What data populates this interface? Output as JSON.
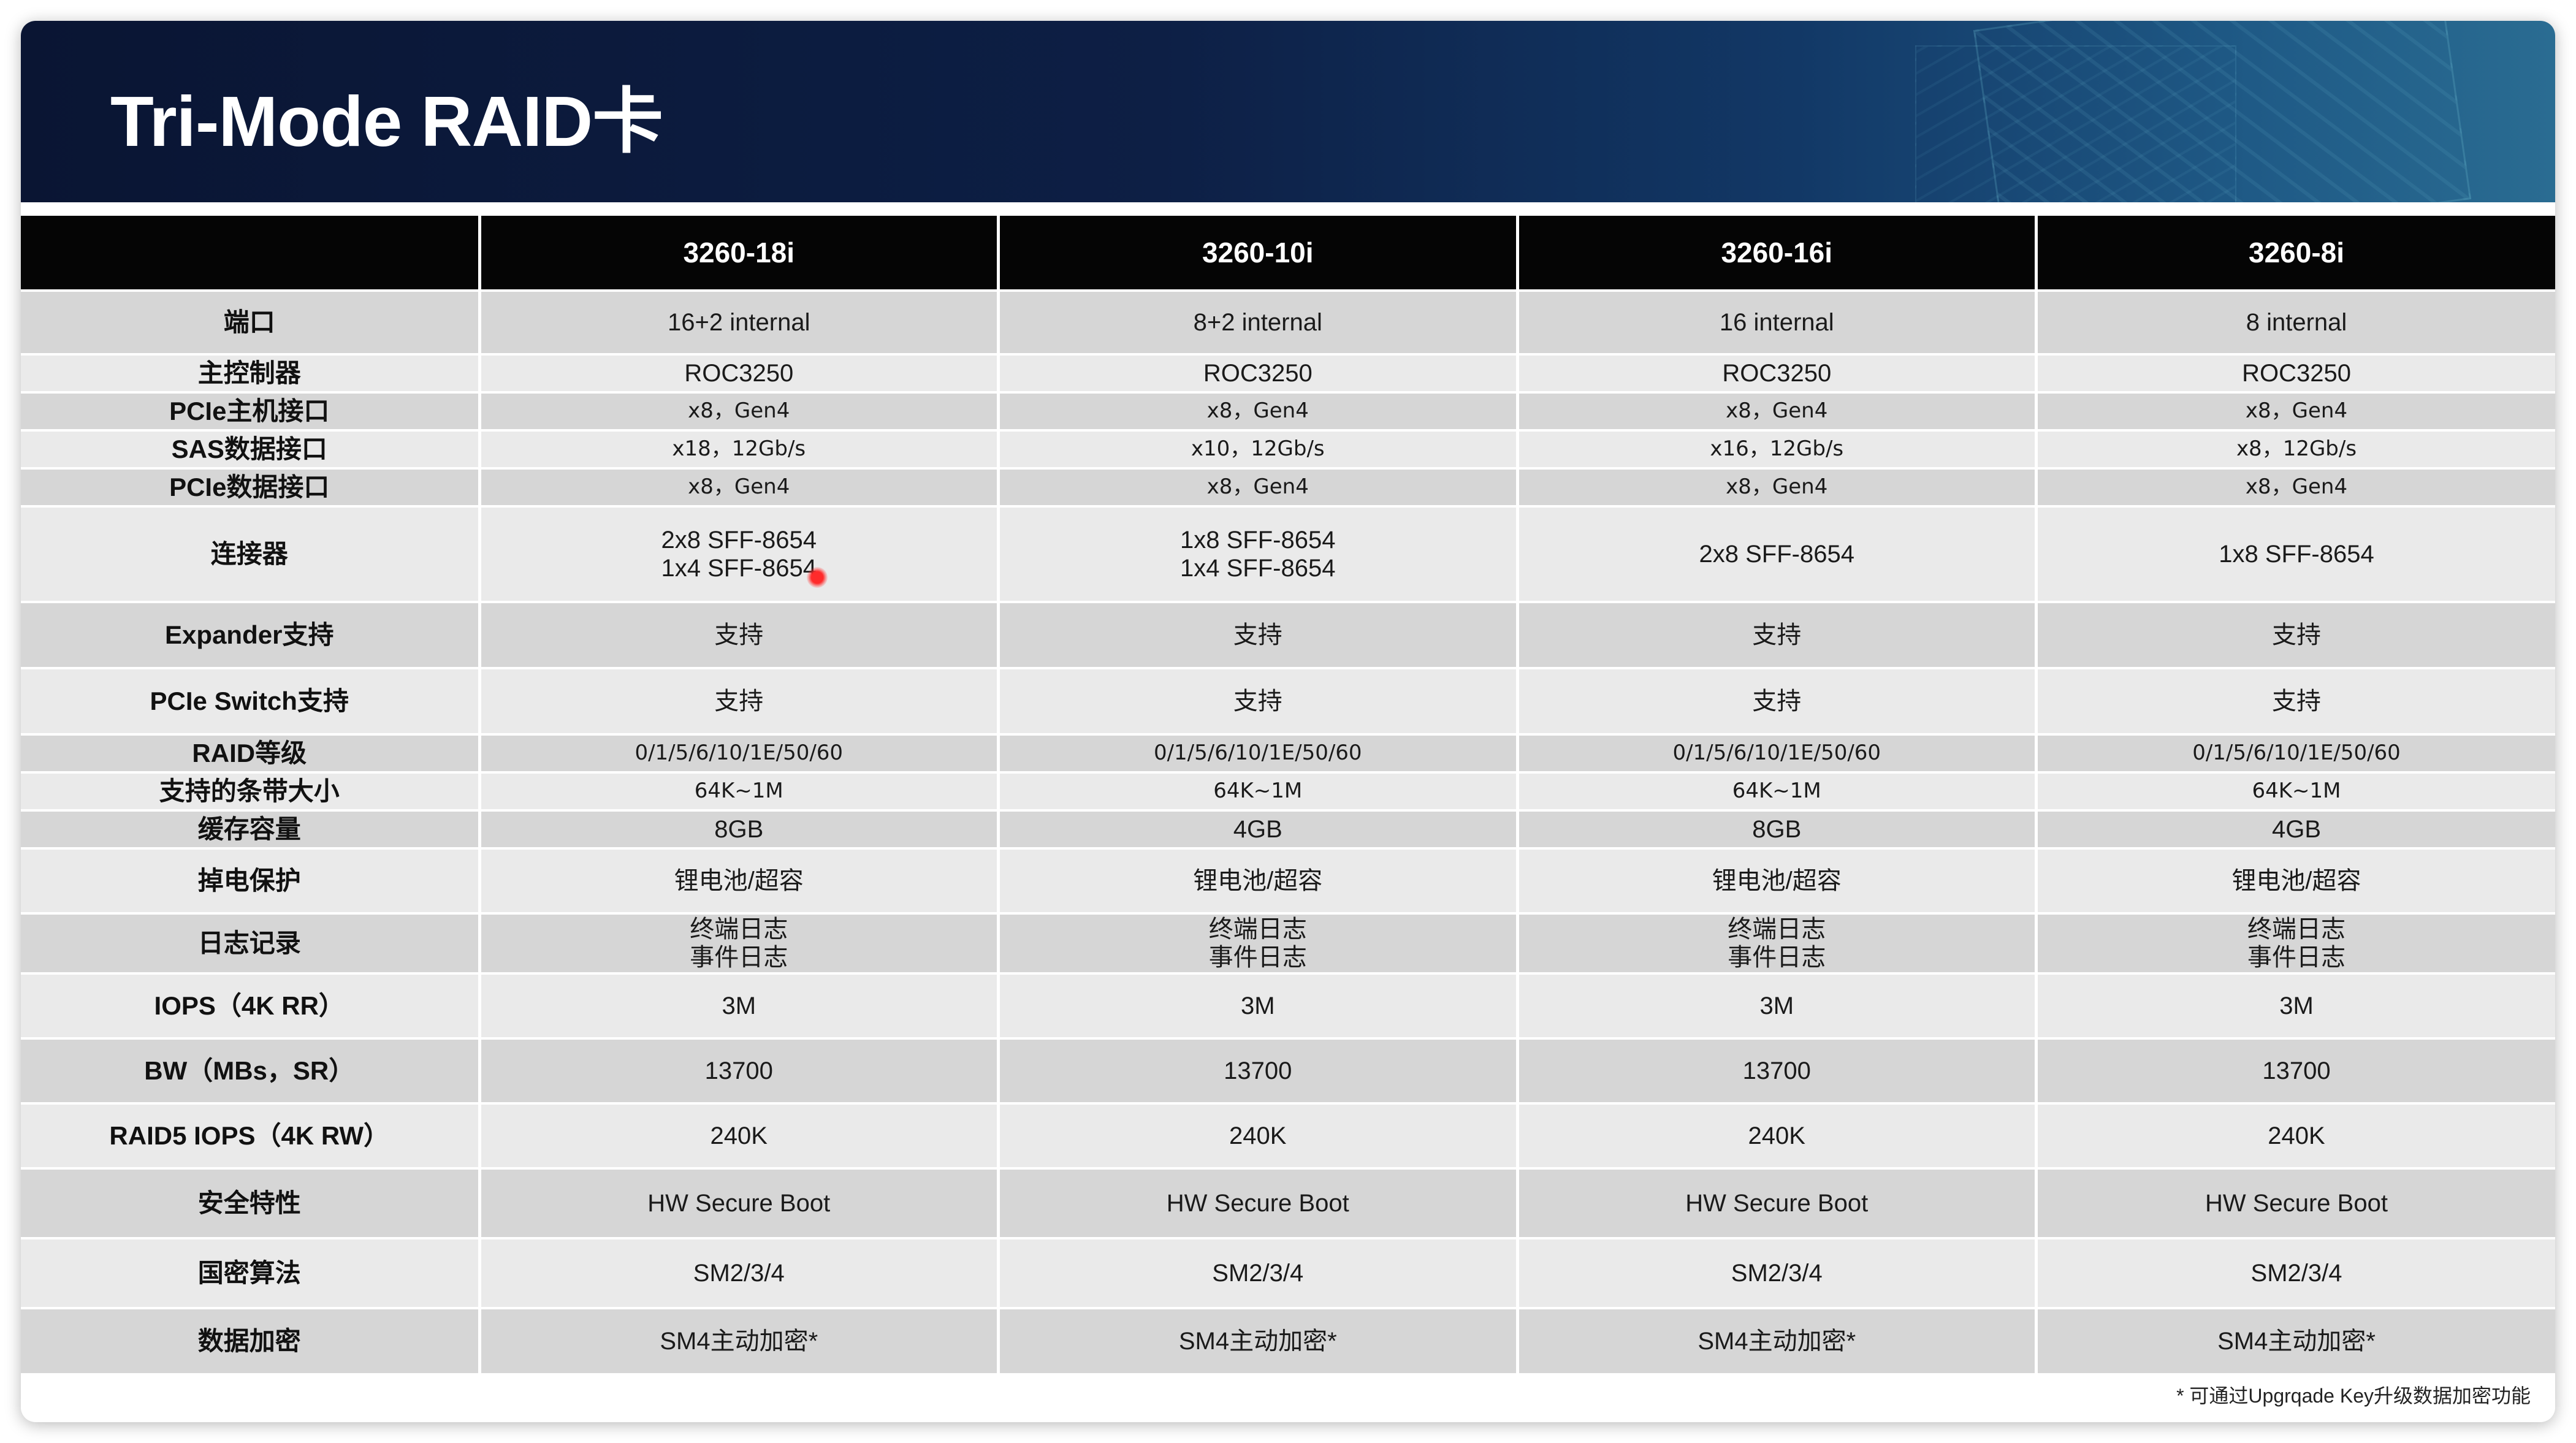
{
  "title": "Tri-Mode RAID卡",
  "models": [
    "3260-18i",
    "3260-10i",
    "3260-16i",
    "3260-8i"
  ],
  "rows": [
    {
      "label": "端口",
      "values": [
        "16+2 internal",
        "8+2 internal",
        "16 internal",
        "8 internal"
      ]
    },
    {
      "label": "主控制器",
      "values": [
        "ROC3250",
        "ROC3250",
        "ROC3250",
        "ROC3250"
      ]
    },
    {
      "label": "PCIe主机接口",
      "values": [
        "x8，Gen4",
        "x8，Gen4",
        "x8，Gen4",
        "x8，Gen4"
      ]
    },
    {
      "label": "SAS数据接口",
      "values": [
        "x18，12Gb/s",
        "x10，12Gb/s",
        "x16，12Gb/s",
        "x8，12Gb/s"
      ]
    },
    {
      "label": "PCIe数据接口",
      "values": [
        "x8，Gen4",
        "x8，Gen4",
        "x8，Gen4",
        "x8，Gen4"
      ]
    },
    {
      "label": "连接器",
      "values": [
        [
          "2x8 SFF-8654",
          "1x4 SFF-8654"
        ],
        [
          "1x8 SFF-8654",
          "1x4 SFF-8654"
        ],
        [
          "2x8 SFF-8654"
        ],
        [
          "1x8 SFF-8654"
        ]
      ]
    },
    {
      "label": "Expander支持",
      "values": [
        "支持",
        "支持",
        "支持",
        "支持"
      ]
    },
    {
      "label": "PCIe Switch支持",
      "values": [
        "支持",
        "支持",
        "支持",
        "支持"
      ]
    },
    {
      "label": "RAID等级",
      "values": [
        "0/1/5/6/10/1E/50/60",
        "0/1/5/6/10/1E/50/60",
        "0/1/5/6/10/1E/50/60",
        "0/1/5/6/10/1E/50/60"
      ]
    },
    {
      "label": "支持的条带大小",
      "values": [
        "64K~1M",
        "64K~1M",
        "64K~1M",
        "64K~1M"
      ]
    },
    {
      "label": "缓存容量",
      "values": [
        "8GB",
        "4GB",
        "8GB",
        "4GB"
      ]
    },
    {
      "label": "掉电保护",
      "values": [
        "锂电池/超容",
        "锂电池/超容",
        "锂电池/超容",
        "锂电池/超容"
      ]
    },
    {
      "label": "日志记录",
      "values": [
        [
          "终端日志",
          "事件日志"
        ],
        [
          "终端日志",
          "事件日志"
        ],
        [
          "终端日志",
          "事件日志"
        ],
        [
          "终端日志",
          "事件日志"
        ]
      ]
    },
    {
      "label": "IOPS（4K RR）",
      "values": [
        "3M",
        "3M",
        "3M",
        "3M"
      ]
    },
    {
      "label": "BW（MBs，SR）",
      "values": [
        "13700",
        "13700",
        "13700",
        "13700"
      ]
    },
    {
      "label": "RAID5 IOPS（4K RW）",
      "values": [
        "240K",
        "240K",
        "240K",
        "240K"
      ]
    },
    {
      "label": "安全特性",
      "values": [
        "HW Secure Boot",
        "HW Secure Boot",
        "HW Secure Boot",
        "HW Secure Boot"
      ]
    },
    {
      "label": "国密算法",
      "values": [
        "SM2/3/4",
        "SM2/3/4",
        "SM2/3/4",
        "SM2/3/4"
      ]
    },
    {
      "label": "数据加密",
      "values": [
        "SM4主动加密*",
        "SM4主动加密*",
        "SM4主动加密*",
        "SM4主动加密*"
      ]
    }
  ],
  "footnote": "* 可通过Upgrqade Key升级数据加密功能"
}
